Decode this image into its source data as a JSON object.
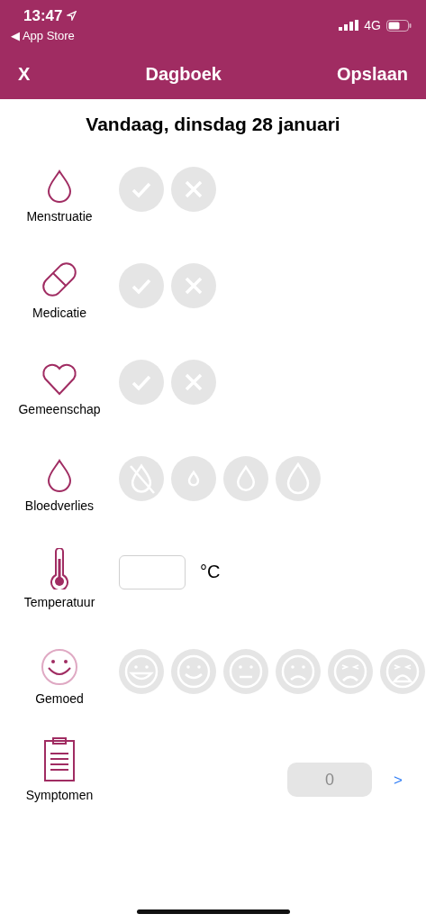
{
  "status_bar": {
    "time": "13:47",
    "back_app": "◀ App Store",
    "network": "4G"
  },
  "nav": {
    "close": "X",
    "title": "Dagboek",
    "save": "Opslaan"
  },
  "date_title": "Vandaag, dinsdag 28 januari",
  "rows": [
    {
      "kind": "yesno",
      "label": "Menstruatie",
      "options": [
        {
          "selected": false
        },
        {
          "selected": false
        }
      ]
    },
    {
      "kind": "yesno",
      "label": "Medicatie",
      "options": [
        {
          "selected": false
        },
        {
          "selected": false
        }
      ]
    },
    {
      "kind": "yesno",
      "label": "Gemeenschap",
      "options": [
        {
          "selected": false
        },
        {
          "selected": false
        }
      ]
    },
    {
      "kind": "blood",
      "label": "Bloedverlies",
      "options": [
        {
          "selected": false
        },
        {
          "selected": false
        },
        {
          "selected": false
        },
        {
          "selected": false
        }
      ]
    },
    {
      "kind": "temperature",
      "label": "Temperatuur",
      "unit": "°C"
    },
    {
      "kind": "mood",
      "label": "Gemoed",
      "options": [
        {
          "selected": false
        },
        {
          "selected": false
        },
        {
          "selected": false
        },
        {
          "selected": false
        },
        {
          "selected": false
        },
        {
          "selected": false
        }
      ]
    },
    {
      "kind": "symptoms",
      "label": "Symptomen",
      "count": "0",
      "chevron": ">"
    }
  ]
}
